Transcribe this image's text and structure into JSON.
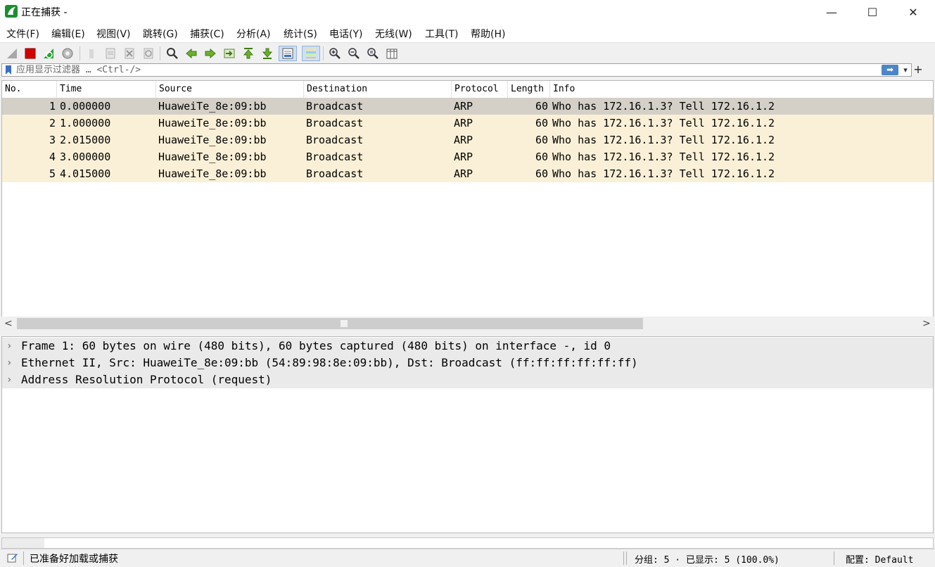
{
  "window": {
    "title": "正在捕获 -",
    "minimize": "—",
    "maximize": "☐",
    "close": "✕"
  },
  "menu": [
    {
      "label": "文件(F)"
    },
    {
      "label": "编辑(E)"
    },
    {
      "label": "视图(V)"
    },
    {
      "label": "跳转(G)"
    },
    {
      "label": "捕获(C)"
    },
    {
      "label": "分析(A)"
    },
    {
      "label": "统计(S)"
    },
    {
      "label": "电话(Y)"
    },
    {
      "label": "无线(W)"
    },
    {
      "label": "工具(T)"
    },
    {
      "label": "帮助(H)"
    }
  ],
  "toolbar": {
    "icons": [
      "shark-fin-start-icon",
      "stop-capture-icon",
      "restart-capture-icon",
      "capture-options-icon",
      "open-file-icon",
      "save-file-icon",
      "close-file-icon",
      "reload-file-icon",
      "find-packet-icon",
      "go-back-icon",
      "go-forward-icon",
      "go-to-packet-icon",
      "first-packet-icon",
      "last-packet-icon",
      "auto-scroll-icon",
      "colorize-icon",
      "zoom-in-icon",
      "zoom-out-icon",
      "normal-size-icon",
      "resize-columns-icon"
    ]
  },
  "filter": {
    "placeholder": "应用显示过滤器 … <Ctrl-/>",
    "apply_glyph": "➡",
    "dropdown_glyph": "▾",
    "add_glyph": "+"
  },
  "packet_list": {
    "columns": [
      "No.",
      "Time",
      "Source",
      "Destination",
      "Protocol",
      "Length",
      "Info"
    ],
    "rows": [
      {
        "no": "1",
        "time": "0.000000",
        "source": "HuaweiTe_8e:09:bb",
        "destination": "Broadcast",
        "protocol": "ARP",
        "length": "60",
        "info": "Who has 172.16.1.3? Tell 172.16.1.2",
        "selected": true
      },
      {
        "no": "2",
        "time": "1.000000",
        "source": "HuaweiTe_8e:09:bb",
        "destination": "Broadcast",
        "protocol": "ARP",
        "length": "60",
        "info": "Who has 172.16.1.3? Tell 172.16.1.2",
        "selected": false
      },
      {
        "no": "3",
        "time": "2.015000",
        "source": "HuaweiTe_8e:09:bb",
        "destination": "Broadcast",
        "protocol": "ARP",
        "length": "60",
        "info": "Who has 172.16.1.3? Tell 172.16.1.2",
        "selected": false
      },
      {
        "no": "4",
        "time": "3.000000",
        "source": "HuaweiTe_8e:09:bb",
        "destination": "Broadcast",
        "protocol": "ARP",
        "length": "60",
        "info": "Who has 172.16.1.3? Tell 172.16.1.2",
        "selected": false
      },
      {
        "no": "5",
        "time": "4.015000",
        "source": "HuaweiTe_8e:09:bb",
        "destination": "Broadcast",
        "protocol": "ARP",
        "length": "60",
        "info": "Who has 172.16.1.3? Tell 172.16.1.2",
        "selected": false
      }
    ],
    "row_color": "#faf0d7",
    "selected_color": "#d4d0c8"
  },
  "details": [
    {
      "text": "Frame 1: 60 bytes on wire (480 bits), 60 bytes captured (480 bits) on interface -, id 0"
    },
    {
      "text": "Ethernet II, Src: HuaweiTe_8e:09:bb (54:89:98:8e:09:bb), Dst: Broadcast (ff:ff:ff:ff:ff:ff)"
    },
    {
      "text": "Address Resolution Protocol (request)"
    }
  ],
  "scroll": {
    "left": "<",
    "right": ">"
  },
  "status": {
    "ready": "已准备好加载或捕获",
    "packets": "分组: 5 · 已显示: 5 (100.0%)",
    "profile": "配置: Default"
  }
}
